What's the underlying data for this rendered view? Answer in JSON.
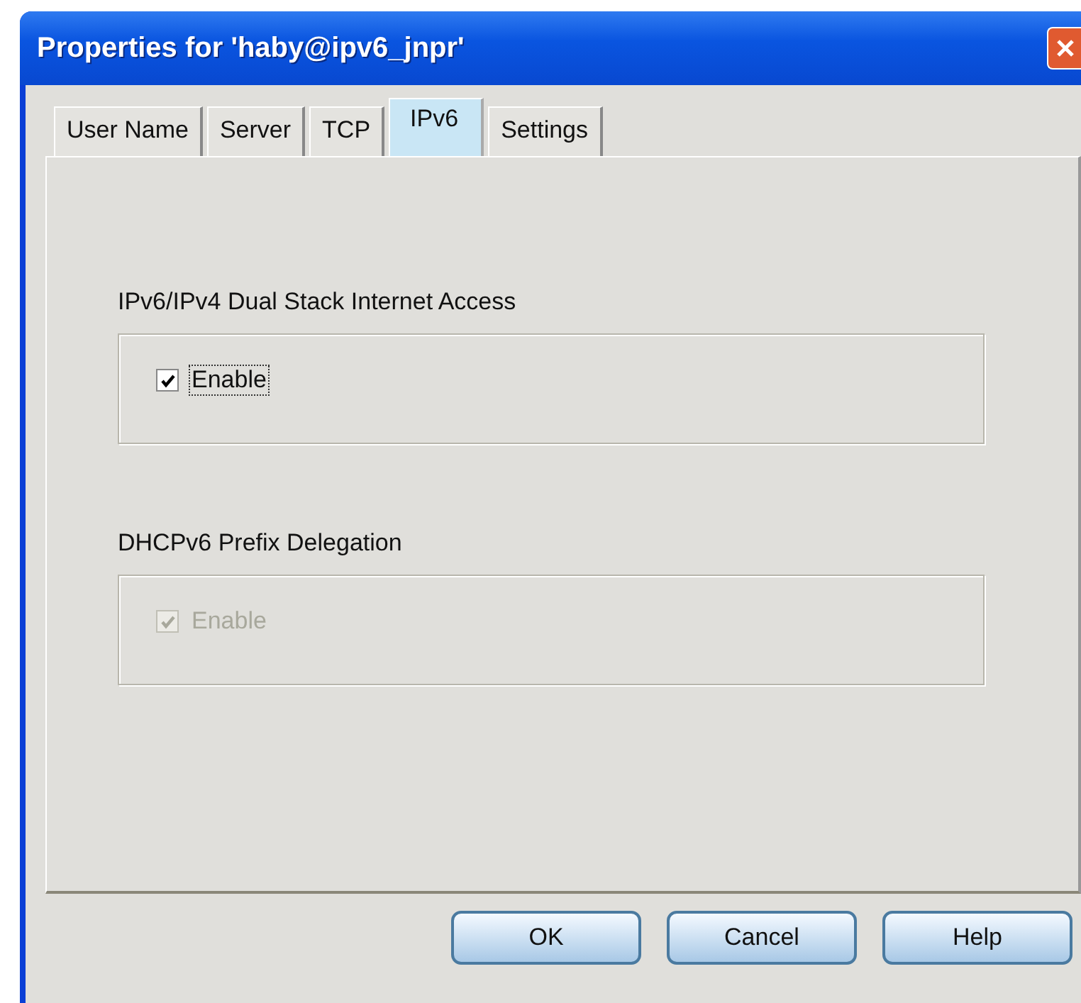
{
  "window": {
    "title": "Properties for 'haby@ipv6_jnpr'"
  },
  "tabs": [
    {
      "label": "User Name",
      "selected": false
    },
    {
      "label": "Server",
      "selected": false
    },
    {
      "label": "TCP",
      "selected": false
    },
    {
      "label": "IPv6",
      "selected": true
    },
    {
      "label": "Settings",
      "selected": false
    }
  ],
  "groups": [
    {
      "title": "IPv6/IPv4 Dual Stack Internet Access",
      "checkbox": {
        "label": "Enable",
        "checked": true,
        "disabled": false,
        "focused": true
      }
    },
    {
      "title": "DHCPv6 Prefix Delegation",
      "checkbox": {
        "label": "Enable",
        "checked": true,
        "disabled": true,
        "focused": false
      }
    }
  ],
  "buttons": [
    "OK",
    "Cancel",
    "Help"
  ]
}
